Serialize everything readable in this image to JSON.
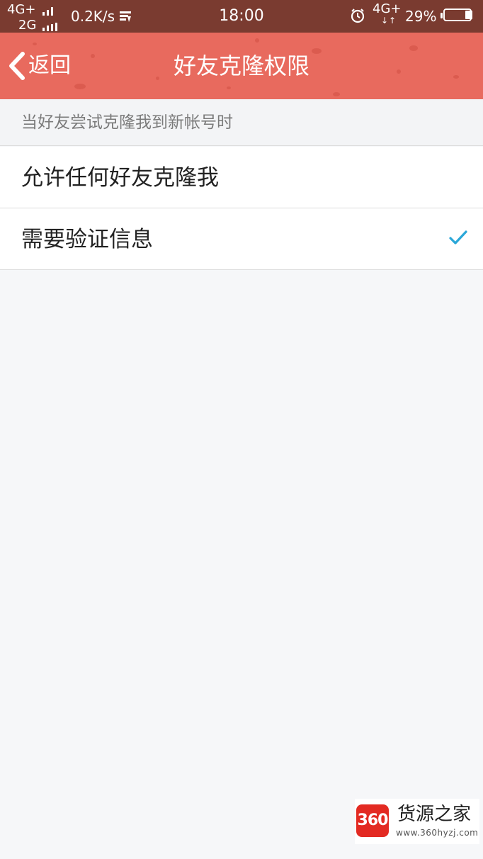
{
  "status_bar": {
    "network_primary": "4G+",
    "network_secondary": "2G",
    "net_speed": "0.2K/s",
    "time": "18:00",
    "network_data": "4G+",
    "data_arrows": "↓↑",
    "battery_percent": "29%",
    "battery_level": 0.29,
    "icons": [
      "signal-bars-icon",
      "data-usage-icon",
      "alarm-icon",
      "battery-icon"
    ]
  },
  "nav": {
    "back_label": "返回",
    "title": "好友克隆权限",
    "bar_color": "#e86a5e"
  },
  "section": {
    "header": "当好友尝试克隆我到新帐号时"
  },
  "options": [
    {
      "label": "允许任何好友克隆我",
      "selected": false
    },
    {
      "label": "需要验证信息",
      "selected": true
    }
  ],
  "accent_color": "#2aa7d8",
  "watermark": {
    "logo_text": "360",
    "name": "货源之家",
    "url": "www.360hyzj.com"
  }
}
